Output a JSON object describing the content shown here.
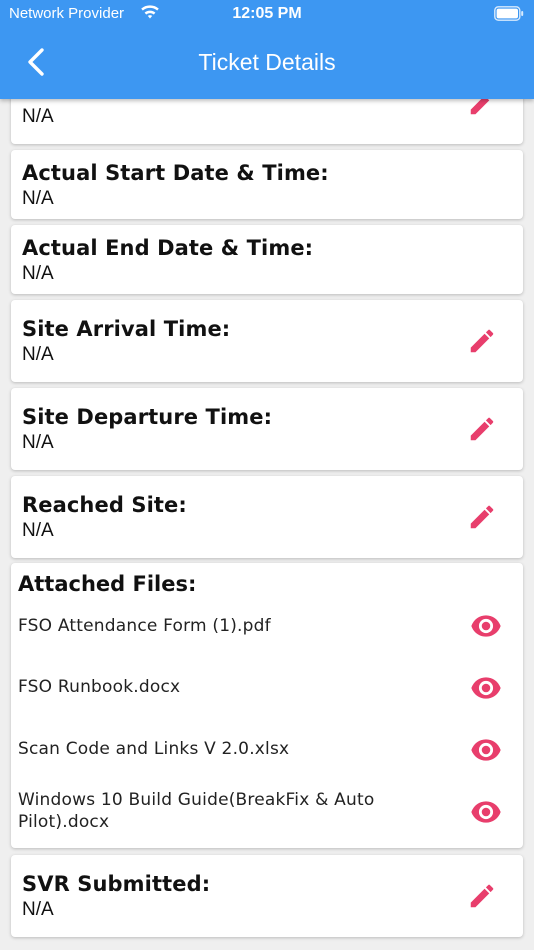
{
  "status_bar": {
    "carrier": "Network Provider",
    "time": "12:05 PM"
  },
  "header": {
    "title": "Ticket Details",
    "back_icon": "chevron-left-icon"
  },
  "colors": {
    "header_bg": "#3d97f2",
    "accent": "#e83e6c",
    "card_bg": "#ffffff",
    "page_bg": "#efefef"
  },
  "fields": {
    "partial": {
      "value": "N/A"
    },
    "actual_start": {
      "label": "Actual Start Date & Time:",
      "value": "N/A"
    },
    "actual_end": {
      "label": "Actual End Date & Time:",
      "value": "N/A"
    },
    "site_arrival": {
      "label": "Site Arrival Time:",
      "value": "N/A"
    },
    "site_departure": {
      "label": "Site Departure Time:",
      "value": "N/A"
    },
    "reached_site": {
      "label": "Reached Site:",
      "value": "N/A"
    },
    "svr_submitted": {
      "label": "SVR Submitted:",
      "value": "N/A"
    }
  },
  "attached_files": {
    "label": "Attached Files:",
    "files": [
      {
        "name": "FSO Attendance Form (1).pdf"
      },
      {
        "name": "FSO Runbook.docx"
      },
      {
        "name": "Scan Code and Links V 2.0.xlsx"
      },
      {
        "name": "Windows 10 Build Guide(BreakFix & Auto Pilot).docx"
      }
    ]
  }
}
